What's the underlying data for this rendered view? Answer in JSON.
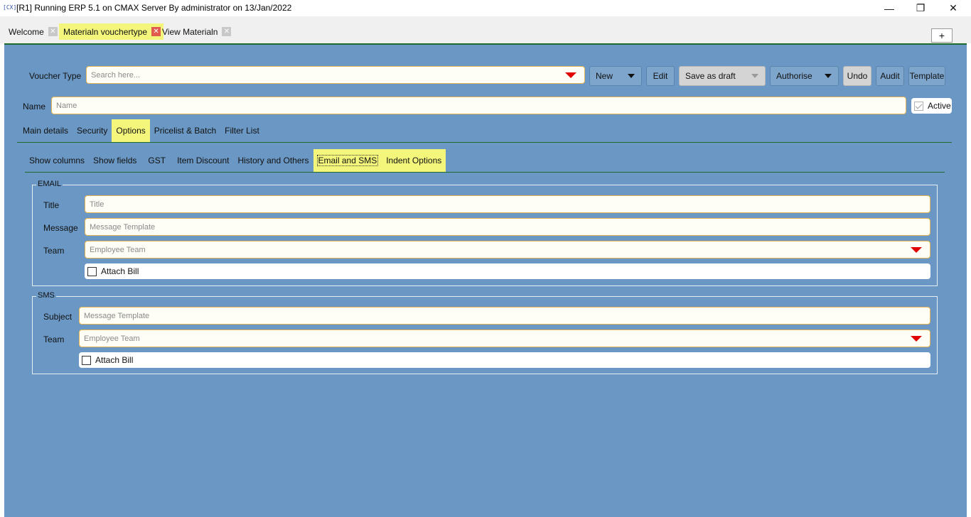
{
  "window": {
    "icon": "[CX]",
    "title": "[R1] Running ERP 5.1 on CMAX Server By administrator on 13/Jan/2022",
    "minimize": "—",
    "maximize": "❐",
    "close": "✕"
  },
  "doc_tabs": [
    {
      "label": "Welcome",
      "close": "✕"
    },
    {
      "label": "Materialn vouchertype",
      "close": "✕"
    },
    {
      "label": "View Materialn",
      "close": "✕"
    }
  ],
  "plus_label": "+",
  "toolbar": {
    "voucher_type_label": "Voucher Type",
    "voucher_type_placeholder": "Search here...",
    "new_label": "New",
    "edit_label": "Edit",
    "save_draft_label": "Save as draft",
    "authorise_label": "Authorise",
    "undo_label": "Undo",
    "audit_label": "Audit",
    "template_label": "Template"
  },
  "name_row": {
    "label": "Name",
    "placeholder": "Name",
    "active_label": "Active",
    "active_checked": true
  },
  "main_tabs": [
    {
      "label": "Main details",
      "selected": false
    },
    {
      "label": "Security",
      "selected": false
    },
    {
      "label": "Options",
      "selected": true
    },
    {
      "label": "Pricelist & Batch",
      "selected": false
    },
    {
      "label": "Filter List",
      "selected": false
    }
  ],
  "option_tabs": [
    {
      "label": "Show columns",
      "selected": false
    },
    {
      "label": "Show fields",
      "selected": false
    },
    {
      "label": "GST",
      "selected": false
    },
    {
      "label": "Item Discount",
      "selected": false
    },
    {
      "label": "History and Others",
      "selected": false
    },
    {
      "label": "Email and SMS",
      "selected": true
    },
    {
      "label": "Indent Options",
      "selected": true
    }
  ],
  "email": {
    "legend": "EMAIL",
    "title_label": "Title",
    "title_placeholder": "Title",
    "message_label": "Message",
    "message_placeholder": "Message Template",
    "team_label": "Team",
    "team_placeholder": "Employee Team",
    "attach_label": "Attach Bill"
  },
  "sms": {
    "legend": "SMS",
    "subject_label": "Subject",
    "subject_placeholder": "Message Template",
    "team_label": "Team",
    "team_placeholder": "Employee Team",
    "attach_label": "Attach Bill"
  },
  "colors": {
    "panel_bg": "#6a97c3",
    "selected_tab": "#f3f67a",
    "field_border": "#e8b554",
    "dropdown_arrow": "#e00000",
    "rule": "#1e6a2a"
  }
}
